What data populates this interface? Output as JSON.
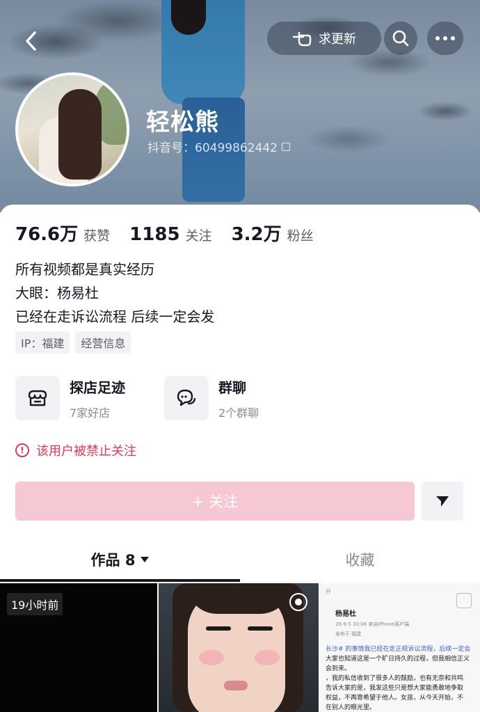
{
  "header": {
    "update_label": "求更新",
    "nickname": "轻松熊",
    "douyin_id": "抖音号：60499862442"
  },
  "stats": [
    {
      "num": "76.6万",
      "label": "获赞"
    },
    {
      "num": "1185",
      "label": "关注"
    },
    {
      "num": "3.2万",
      "label": "粉丝"
    }
  ],
  "bio": [
    "所有视频都是真实经历",
    "大眼：杨易杜",
    "已经在走诉讼流程 后续一定会发"
  ],
  "tags": [
    "IP：福建",
    "经营信息"
  ],
  "features": [
    {
      "title": "探店足迹",
      "sub": "7家好店",
      "icon": "store-icon"
    },
    {
      "title": "群聊",
      "sub": "2个群聊",
      "icon": "group-chat-icon"
    }
  ],
  "warning": "该用户被禁止关注",
  "follow_label": "+ 关注",
  "tabs": {
    "works": "作品 8",
    "favorites": "收藏"
  },
  "videos": {
    "first_time": "19小时前",
    "doc": {
      "top": "开",
      "author": "杨易杜",
      "meta": "26-9-5 20:06 来自iPhone客户端",
      "meta2": "发布于 福建",
      "lines": [
        "长沙# 的事情我已经在走正规诉讼流程，后续一定会",
        "大家也知道这是一个旷日持久的过程，但我相信正义",
        "会到来。",
        "，我的私信收到了很多人的鼓励，也有无奈和共鸣",
        "告诉大家的是，我发这些只是想大家能勇敢地争取",
        "权益，不再寄希望于他人。女孩，从今天开始，不",
        "在别人的眼光里。"
      ]
    }
  },
  "colors": {
    "accent_pink": "#f5c8d3",
    "warning_red": "#e8384f",
    "text_primary": "#161823",
    "text_secondary": "#8a8b91"
  }
}
